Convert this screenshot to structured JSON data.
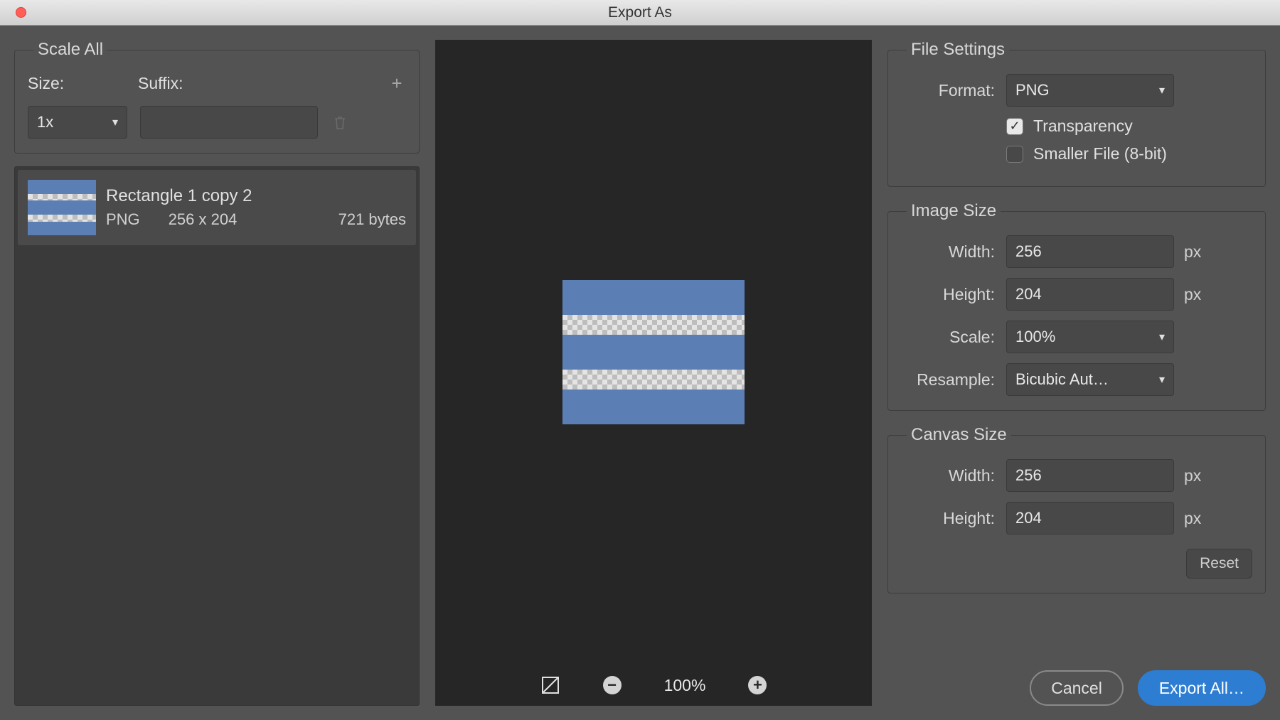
{
  "window": {
    "title": "Export As"
  },
  "scale_all": {
    "legend": "Scale All",
    "size_label": "Size:",
    "suffix_label": "Suffix:",
    "size_value": "1x",
    "suffix_value": ""
  },
  "asset": {
    "name": "Rectangle 1 copy 2",
    "format": "PNG",
    "dimensions": "256 x 204",
    "filesize": "721 bytes"
  },
  "zoom": {
    "value": "100%"
  },
  "file_settings": {
    "legend": "File Settings",
    "format_label": "Format:",
    "format_value": "PNG",
    "transparency_label": "Transparency",
    "transparency_checked": true,
    "smaller_file_label": "Smaller File (8-bit)",
    "smaller_file_checked": false
  },
  "image_size": {
    "legend": "Image Size",
    "width_label": "Width:",
    "width_value": "256",
    "height_label": "Height:",
    "height_value": "204",
    "scale_label": "Scale:",
    "scale_value": "100%",
    "resample_label": "Resample:",
    "resample_value": "Bicubic Aut…",
    "px": "px"
  },
  "canvas_size": {
    "legend": "Canvas Size",
    "width_label": "Width:",
    "width_value": "256",
    "height_label": "Height:",
    "height_value": "204",
    "reset_label": "Reset",
    "px": "px"
  },
  "buttons": {
    "cancel": "Cancel",
    "export": "Export All…"
  }
}
